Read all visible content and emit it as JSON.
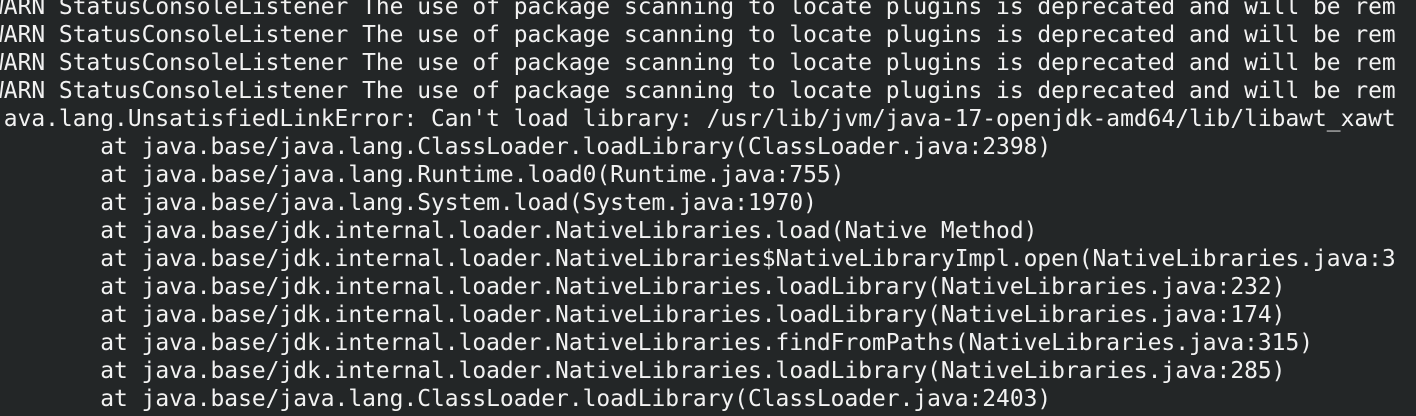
{
  "terminal": {
    "lines": [
      "WARN StatusConsoleListener The use of package scanning to locate plugins is deprecated and will be rem",
      "WARN StatusConsoleListener The use of package scanning to locate plugins is deprecated and will be rem",
      "WARN StatusConsoleListener The use of package scanning to locate plugins is deprecated and will be rem",
      "WARN StatusConsoleListener The use of package scanning to locate plugins is deprecated and will be rem",
      "java.lang.UnsatisfiedLinkError: Can't load library: /usr/lib/jvm/java-17-openjdk-amd64/lib/libawt_xawt",
      "\tat java.base/java.lang.ClassLoader.loadLibrary(ClassLoader.java:2398)",
      "\tat java.base/java.lang.Runtime.load0(Runtime.java:755)",
      "\tat java.base/java.lang.System.load(System.java:1970)",
      "\tat java.base/jdk.internal.loader.NativeLibraries.load(Native Method)",
      "\tat java.base/jdk.internal.loader.NativeLibraries$NativeLibraryImpl.open(NativeLibraries.java:3",
      "\tat java.base/jdk.internal.loader.NativeLibraries.loadLibrary(NativeLibraries.java:232)",
      "\tat java.base/jdk.internal.loader.NativeLibraries.loadLibrary(NativeLibraries.java:174)",
      "\tat java.base/jdk.internal.loader.NativeLibraries.findFromPaths(NativeLibraries.java:315)",
      "\tat java.base/jdk.internal.loader.NativeLibraries.loadLibrary(NativeLibraries.java:285)",
      "\tat java.base/java.lang.ClassLoader.loadLibrary(ClassLoader.java:2403)"
    ]
  }
}
